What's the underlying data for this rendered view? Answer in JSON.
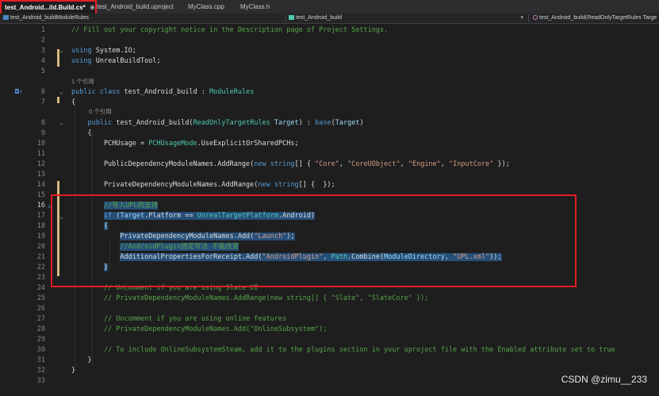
{
  "tabs": [
    {
      "label": "test_Android...ild.Build.cs*",
      "pin": "⊕",
      "close": "✕",
      "active": true
    },
    {
      "label": "test_Android_build.uproject",
      "active": false
    },
    {
      "label": "MyClass.cpp",
      "active": false
    },
    {
      "label": "MyClass.h",
      "active": false
    }
  ],
  "navbar": {
    "file": "test_Android_buildModuleRules",
    "project": "test_Android_build",
    "member": "test_Android_build(ReadOnlyTargetRules Targe"
  },
  "codelens": {
    "line5": "1 个引用",
    "line7": "0 个引用"
  },
  "lines": [
    {
      "n": "1",
      "text": "// Fill out your copyright notice in the Description page of Project Settings."
    },
    {
      "n": "2",
      "text": ""
    },
    {
      "n": "3",
      "text": "using System.IO;"
    },
    {
      "n": "4",
      "text": "using UnrealBuildTool;"
    },
    {
      "n": "5",
      "text": ""
    },
    {
      "n": "6",
      "text": "public class test_Android_build : ModuleRules"
    },
    {
      "n": "7",
      "text": "{"
    },
    {
      "n": "8",
      "text": "    public test_Android_build(ReadOnlyTargetRules Target) : base(Target)"
    },
    {
      "n": "9",
      "text": "    {"
    },
    {
      "n": "10",
      "text": "        PCHUsage = PCHUsageMode.UseExplicitOrSharedPCHs;"
    },
    {
      "n": "11",
      "text": ""
    },
    {
      "n": "12",
      "text": "        PublicDependencyModuleNames.AddRange(new string[] { \"Core\", \"CoreUObject\", \"Engine\", \"InputCore\" });"
    },
    {
      "n": "13",
      "text": ""
    },
    {
      "n": "14",
      "text": "        PrivateDependencyModuleNames.AddRange(new string[] {  });"
    },
    {
      "n": "15",
      "text": ""
    },
    {
      "n": "16",
      "text": "        //导入UPL的支持"
    },
    {
      "n": "17",
      "text": "        if (Target.Platform == UnrealTargetPlatform.Android)"
    },
    {
      "n": "18",
      "text": "        {"
    },
    {
      "n": "19",
      "text": "            PrivateDependencyModuleNames.Add(\"Launch\");"
    },
    {
      "n": "20",
      "text": "            //AndroidPlugin固定写法 不能改变"
    },
    {
      "n": "21",
      "text": "            AdditionalPropertiesForReceipt.Add(\"AndroidPlugin\", Path.Combine(ModuleDirectory, \"UPL.xml\"));"
    },
    {
      "n": "22",
      "text": "        }"
    },
    {
      "n": "23",
      "text": ""
    },
    {
      "n": "24",
      "text": "        // Uncomment if you are using Slate UI"
    },
    {
      "n": "25",
      "text": "        // PrivateDependencyModuleNames.AddRange(new string[] { \"Slate\", \"SlateCore\" });"
    },
    {
      "n": "26",
      "text": ""
    },
    {
      "n": "27",
      "text": "        // Uncomment if you are using online features"
    },
    {
      "n": "28",
      "text": "        // PrivateDependencyModuleNames.Add(\"OnlineSubsystem\");"
    },
    {
      "n": "29",
      "text": ""
    },
    {
      "n": "30",
      "text": "        // To include OnlineSubsystemSteam, add it to the plugins section in your uproject file with the Enabled attribute set to true"
    },
    {
      "n": "31",
      "text": "    }"
    },
    {
      "n": "32",
      "text": "}"
    },
    {
      "n": "33",
      "text": ""
    }
  ],
  "watermark": "CSDN @zimu__233",
  "colors": {
    "keyword": "#569cd6",
    "type": "#4ec9b0",
    "string": "#d69d85",
    "comment": "#57a64a",
    "highlight": "#e31e24"
  }
}
